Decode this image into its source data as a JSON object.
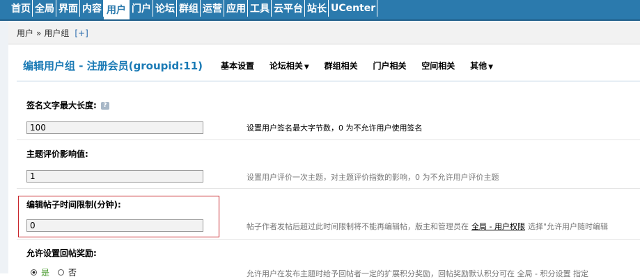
{
  "nav": {
    "items": [
      {
        "label": "首页",
        "active": false
      },
      {
        "label": "全局",
        "active": false
      },
      {
        "label": "界面",
        "active": false
      },
      {
        "label": "内容",
        "active": false
      },
      {
        "label": "用户",
        "active": true
      },
      {
        "label": "门户",
        "active": false
      },
      {
        "label": "论坛",
        "active": false
      },
      {
        "label": "群组",
        "active": false
      },
      {
        "label": "运营",
        "active": false
      },
      {
        "label": "应用",
        "active": false
      },
      {
        "label": "工具",
        "active": false
      },
      {
        "label": "云平台",
        "active": false
      },
      {
        "label": "站长",
        "active": false
      },
      {
        "label": "UCenter",
        "active": false
      }
    ]
  },
  "breadcrumb": {
    "root": "用户",
    "sep": "»",
    "current": "用户组",
    "plus": "[+]"
  },
  "header": {
    "title": "编辑用户组 - 注册会员(groupid:11)",
    "tabs": [
      "基本设置",
      "论坛相关",
      "群组相关",
      "门户相关",
      "空间相关",
      "其他"
    ],
    "caret": "▼"
  },
  "fields": {
    "signature": {
      "label": "签名文字最大长度:",
      "help_icon": "?",
      "value": "100",
      "desc": "设置用户签名最大字节数，0 为不允许用户使用签名"
    },
    "thread_rating": {
      "label": "主题评价影响值:",
      "value": "1",
      "desc": "设置用户评价一次主题，对主题评价指数的影响，0 为不允许用户评价主题"
    },
    "edit_time": {
      "label": "编辑帖子时间限制(分钟):",
      "value": "0",
      "desc_before": "帖子作者发帖后超过此时间限制将不能再编辑帖，版主和管理员在",
      "desc_link": "全局 - 用户权限",
      "desc_after": "选择\"允许用户随时编辑"
    },
    "reply_reward": {
      "label": "允许设置回帖奖励:",
      "yes": "是",
      "no": "否",
      "desc": "允许用户在发布主题时给予回帖者一定的扩展积分奖励，回帖奖励默认积分可在 全局 - 积分设置 指定"
    }
  },
  "colors": {
    "accent": "#2b7aad",
    "title": "#1a7ab5",
    "highlight_border": "#c8272d"
  }
}
